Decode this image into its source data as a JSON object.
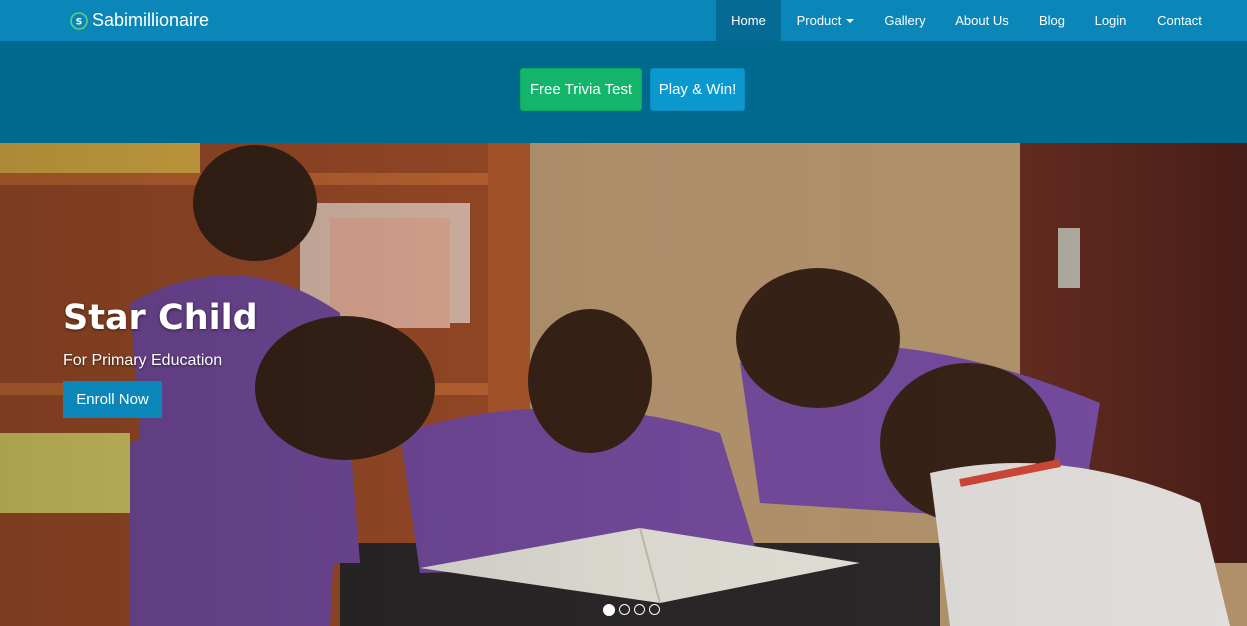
{
  "brand": {
    "name": "Sabimillionaire",
    "logo_icon": "sabimillionaire-logo-icon"
  },
  "nav": {
    "items": [
      {
        "label": "Home",
        "active": true
      },
      {
        "label": "Product",
        "dropdown": true
      },
      {
        "label": "Gallery"
      },
      {
        "label": "About Us"
      },
      {
        "label": "Blog"
      },
      {
        "label": "Login"
      },
      {
        "label": "Contact"
      }
    ]
  },
  "cta": {
    "trivia_label": "Free Trivia Test",
    "play_label": "Play & Win!"
  },
  "hero": {
    "title": "Star Child",
    "subtitle": "For Primary Education",
    "button_label": "Enroll Now",
    "slide_count": 4,
    "active_slide": 1
  },
  "colors": {
    "navbar": "#0a87b8",
    "nav_active": "#066b94",
    "cta_band": "#006a8e",
    "trivia_button": "#12b56a",
    "play_button": "#0a98cf",
    "enroll_button": "#0a87b8"
  }
}
